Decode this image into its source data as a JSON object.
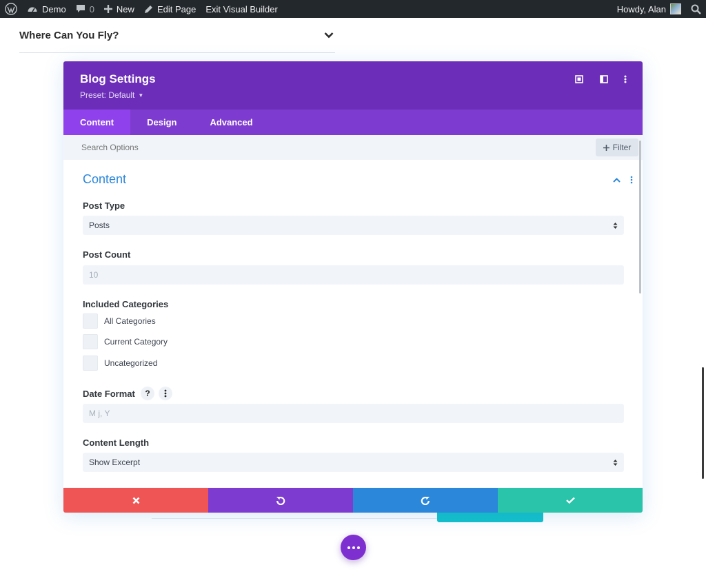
{
  "adminbar": {
    "site_name": "Demo",
    "comments_count": "0",
    "new_label": "New",
    "edit_label": "Edit Page",
    "exit_label": "Exit Visual Builder",
    "greeting": "Howdy, Alan"
  },
  "background": {
    "faq_title": "Where Can You Fly?"
  },
  "modal": {
    "title": "Blog Settings",
    "preset": "Preset: Default",
    "tabs": [
      {
        "label": "Content",
        "active": true
      },
      {
        "label": "Design",
        "active": false
      },
      {
        "label": "Advanced",
        "active": false
      }
    ],
    "search_placeholder": "Search Options",
    "filter_label": "Filter",
    "section_title": "Content",
    "fields": {
      "post_type": {
        "label": "Post Type",
        "value": "Posts"
      },
      "post_count": {
        "label": "Post Count",
        "placeholder": "10"
      },
      "included_categories": {
        "label": "Included Categories",
        "options": [
          "All Categories",
          "Current Category",
          "Uncategorized"
        ]
      },
      "date_format": {
        "label": "Date Format",
        "help": "?",
        "placeholder": "M j, Y"
      },
      "content_length": {
        "label": "Content Length",
        "value": "Show Excerpt"
      }
    },
    "footer_icons": [
      "close-icon",
      "undo-icon",
      "redo-icon",
      "check-icon"
    ]
  },
  "colors": {
    "header": "#6c2eb9",
    "tabs": "#7e3bd0",
    "active_tab": "#8f42ec",
    "accent_blue": "#2b87da",
    "discard": "#ef5555",
    "save": "#29c4a9",
    "adminbar": "#23282d"
  }
}
